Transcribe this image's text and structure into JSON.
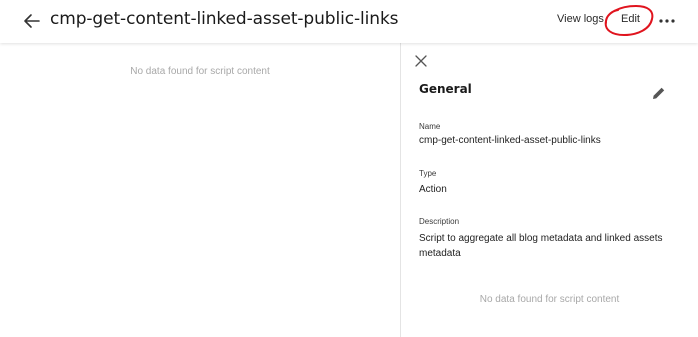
{
  "header": {
    "title": "cmp-get-content-linked-asset-public-links",
    "view_logs_label": "View logs",
    "edit_label": "Edit"
  },
  "main": {
    "empty_message": "No data found for script content"
  },
  "details_panel": {
    "section_title": "General",
    "fields": [
      {
        "label": "Name",
        "value": "cmp-get-content-linked-asset-public-links"
      },
      {
        "label": "Type",
        "value": "Action"
      },
      {
        "label": "Description",
        "value": "Script to aggregate all blog metadata and linked assets metadata"
      }
    ],
    "empty_message": "No data found for script content"
  },
  "icons": {
    "back": "arrow-left-icon",
    "more": "more-horizontal-icon",
    "close": "close-icon",
    "edit": "pencil-icon"
  },
  "colors": {
    "annotation": "#e0141e",
    "muted_text": "#a8a8a8"
  }
}
